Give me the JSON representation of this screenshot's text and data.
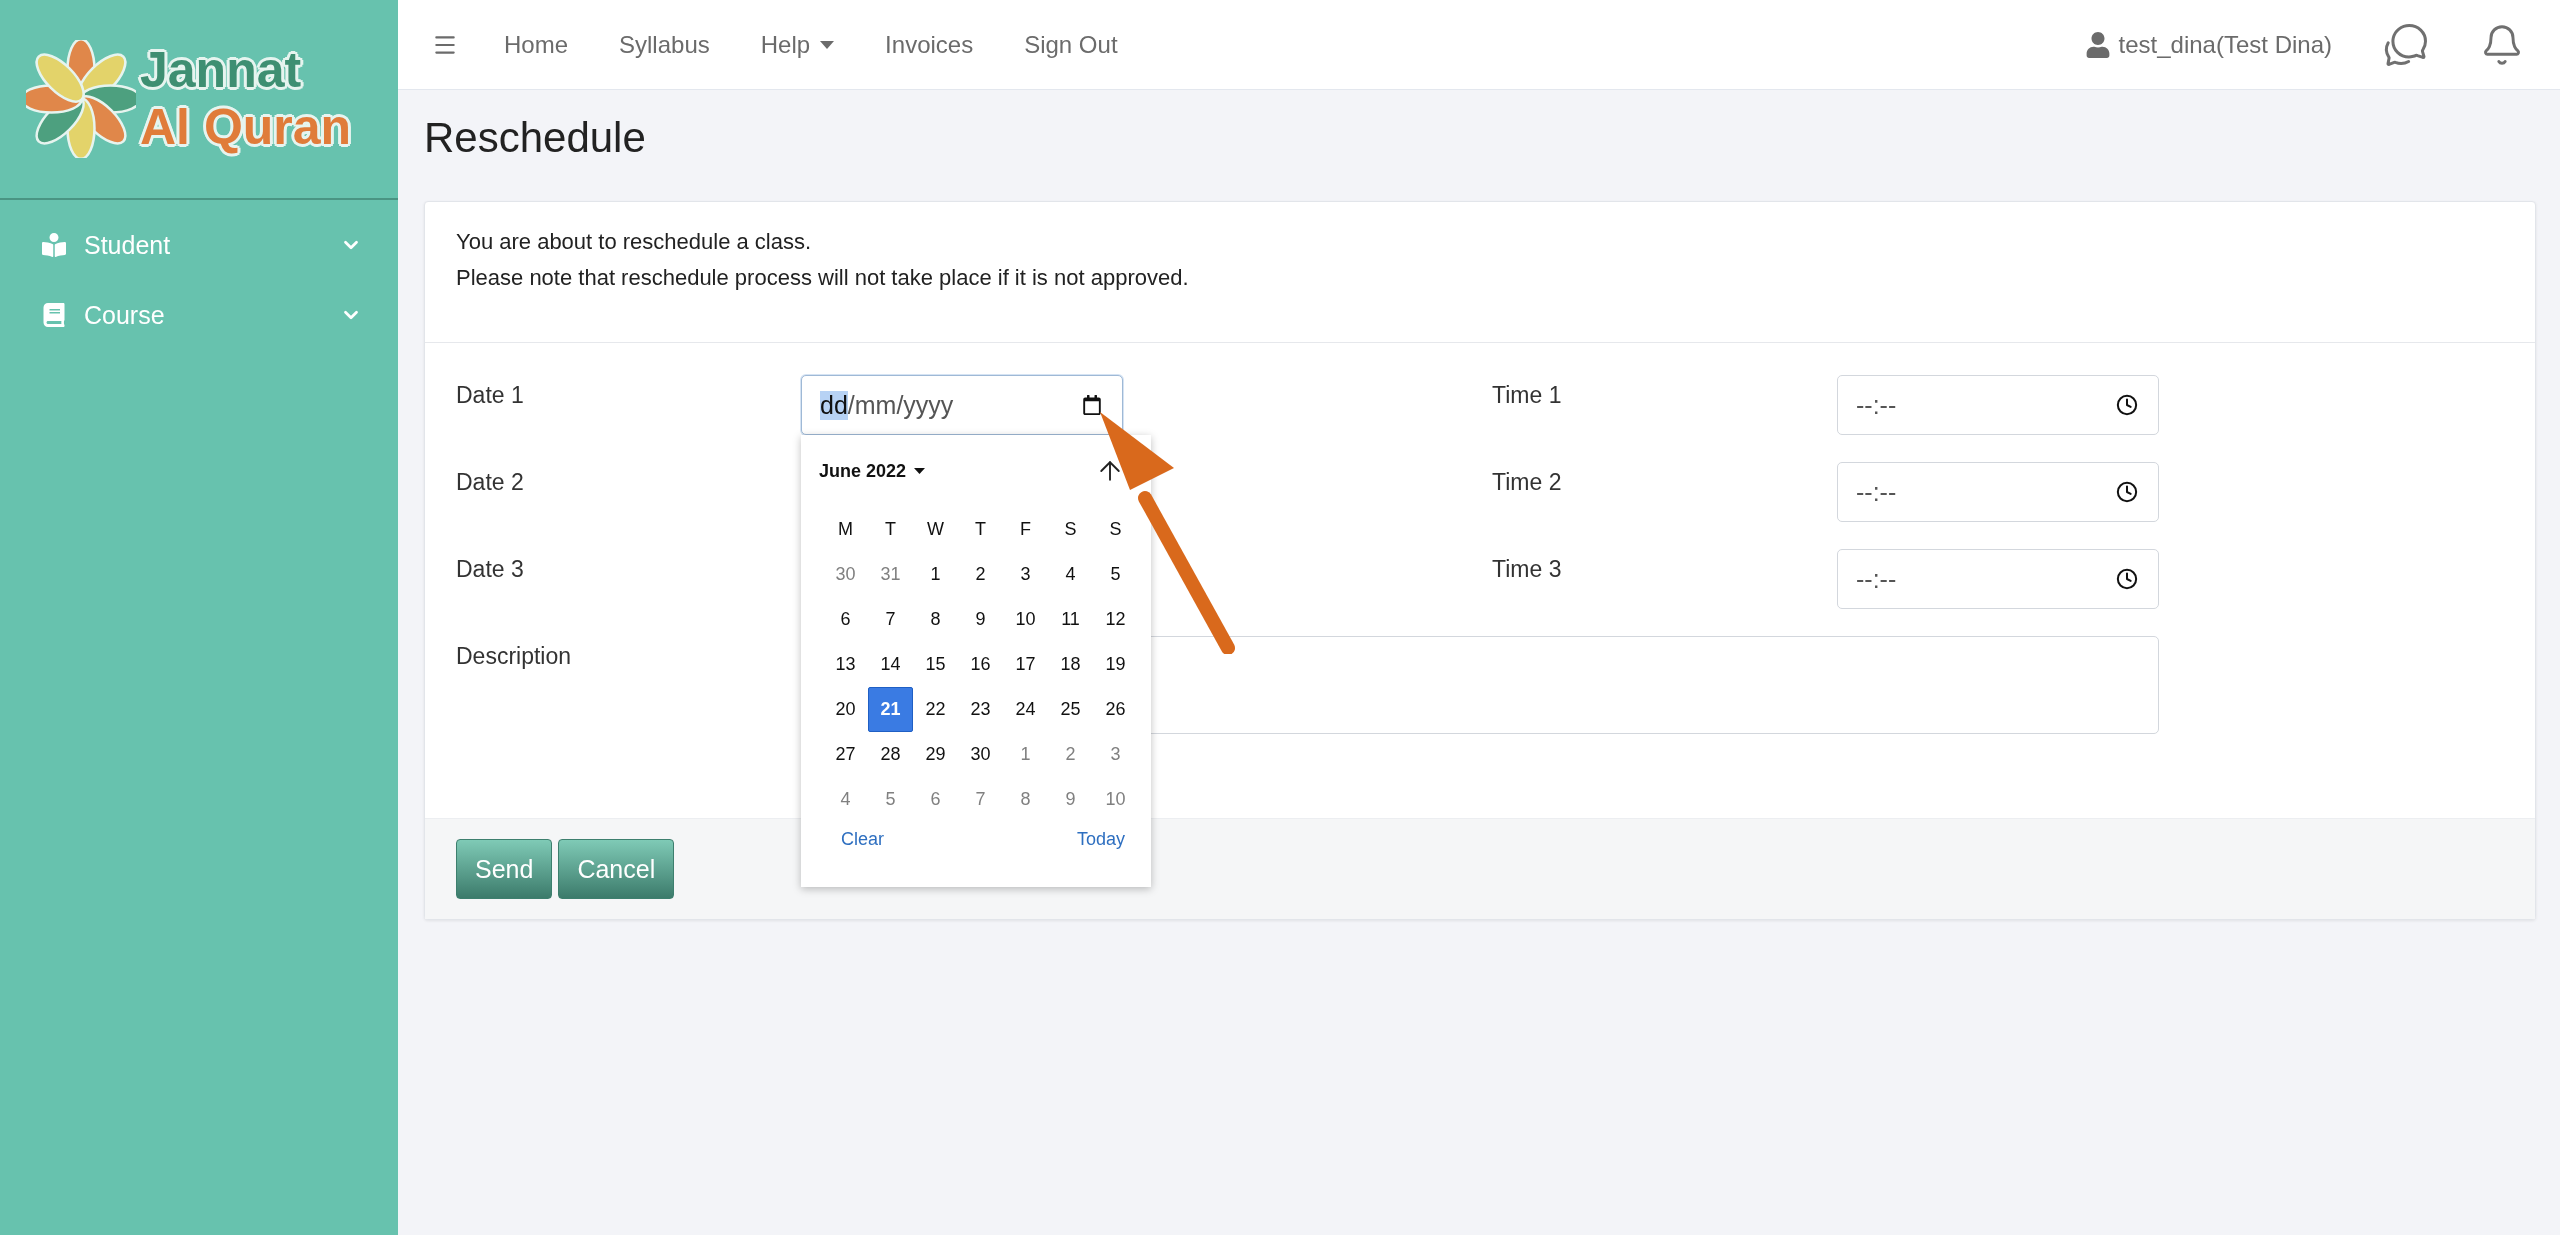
{
  "logo": {
    "line1": "Jannat",
    "line2": "Al Quran"
  },
  "sidebar": {
    "items": [
      {
        "kind": "student",
        "label": "Student",
        "expanded": false
      },
      {
        "kind": "course",
        "label": "Course",
        "expanded": false
      }
    ]
  },
  "topbar": {
    "nav": [
      {
        "label": "Home",
        "dropdown": false
      },
      {
        "label": "Syllabus",
        "dropdown": false
      },
      {
        "label": "Help",
        "dropdown": true
      },
      {
        "label": "Invoices",
        "dropdown": false
      },
      {
        "label": "Sign Out",
        "dropdown": false
      }
    ],
    "user": "test_dina(Test Dina)"
  },
  "page": {
    "title": "Reschedule"
  },
  "card": {
    "intro": [
      "You are about to reschedule a class.",
      "Please note that reschedule process will not take place if it is not approved."
    ],
    "date_labels": [
      "Date 1",
      "Date 2",
      "Date 3"
    ],
    "date_field": {
      "segments": [
        {
          "text": "dd",
          "selected": true
        },
        {
          "text": "/mm/yyyy",
          "selected": false
        }
      ]
    },
    "time_fields": [
      {
        "label": "Time 1",
        "value": "--:--"
      },
      {
        "label": "Time 2",
        "value": "--:--"
      },
      {
        "label": "Time 3",
        "value": "--:--"
      }
    ],
    "description_label": "Description",
    "buttons": [
      "Send",
      "Cancel"
    ]
  },
  "calendar": {
    "month": "June 2022",
    "weekdays": [
      "M",
      "T",
      "W",
      "T",
      "F",
      "S",
      "S"
    ],
    "weeks": [
      [
        {
          "day": "30",
          "outside": true,
          "selected": false
        },
        {
          "day": "31",
          "outside": true,
          "selected": false
        },
        {
          "day": "1",
          "outside": false,
          "selected": false
        },
        {
          "day": "2",
          "outside": false,
          "selected": false
        },
        {
          "day": "3",
          "outside": false,
          "selected": false
        },
        {
          "day": "4",
          "outside": false,
          "selected": false
        },
        {
          "day": "5",
          "outside": false,
          "selected": false
        }
      ],
      [
        {
          "day": "6",
          "outside": false,
          "selected": false
        },
        {
          "day": "7",
          "outside": false,
          "selected": false
        },
        {
          "day": "8",
          "outside": false,
          "selected": false
        },
        {
          "day": "9",
          "outside": false,
          "selected": false
        },
        {
          "day": "10",
          "outside": false,
          "selected": false
        },
        {
          "day": "11",
          "outside": false,
          "selected": false
        },
        {
          "day": "12",
          "outside": false,
          "selected": false
        }
      ],
      [
        {
          "day": "13",
          "outside": false,
          "selected": false
        },
        {
          "day": "14",
          "outside": false,
          "selected": false
        },
        {
          "day": "15",
          "outside": false,
          "selected": false
        },
        {
          "day": "16",
          "outside": false,
          "selected": false
        },
        {
          "day": "17",
          "outside": false,
          "selected": false
        },
        {
          "day": "18",
          "outside": false,
          "selected": false
        },
        {
          "day": "19",
          "outside": false,
          "selected": false
        }
      ],
      [
        {
          "day": "20",
          "outside": false,
          "selected": false
        },
        {
          "day": "21",
          "outside": false,
          "selected": true
        },
        {
          "day": "22",
          "outside": false,
          "selected": false
        },
        {
          "day": "23",
          "outside": false,
          "selected": false
        },
        {
          "day": "24",
          "outside": false,
          "selected": false
        },
        {
          "day": "25",
          "outside": false,
          "selected": false
        },
        {
          "day": "26",
          "outside": false,
          "selected": false
        }
      ],
      [
        {
          "day": "27",
          "outside": false,
          "selected": false
        },
        {
          "day": "28",
          "outside": false,
          "selected": false
        },
        {
          "day": "29",
          "outside": false,
          "selected": false
        },
        {
          "day": "30",
          "outside": false,
          "selected": false
        },
        {
          "day": "1",
          "outside": true,
          "selected": false
        },
        {
          "day": "2",
          "outside": true,
          "selected": false
        },
        {
          "day": "3",
          "outside": true,
          "selected": false
        }
      ],
      [
        {
          "day": "4",
          "outside": true,
          "selected": false
        },
        {
          "day": "5",
          "outside": true,
          "selected": false
        },
        {
          "day": "6",
          "outside": true,
          "selected": false
        },
        {
          "day": "7",
          "outside": true,
          "selected": false
        },
        {
          "day": "8",
          "outside": true,
          "selected": false
        },
        {
          "day": "9",
          "outside": true,
          "selected": false
        },
        {
          "day": "10",
          "outside": true,
          "selected": false
        }
      ]
    ],
    "actions": [
      "Clear",
      "Today"
    ]
  }
}
